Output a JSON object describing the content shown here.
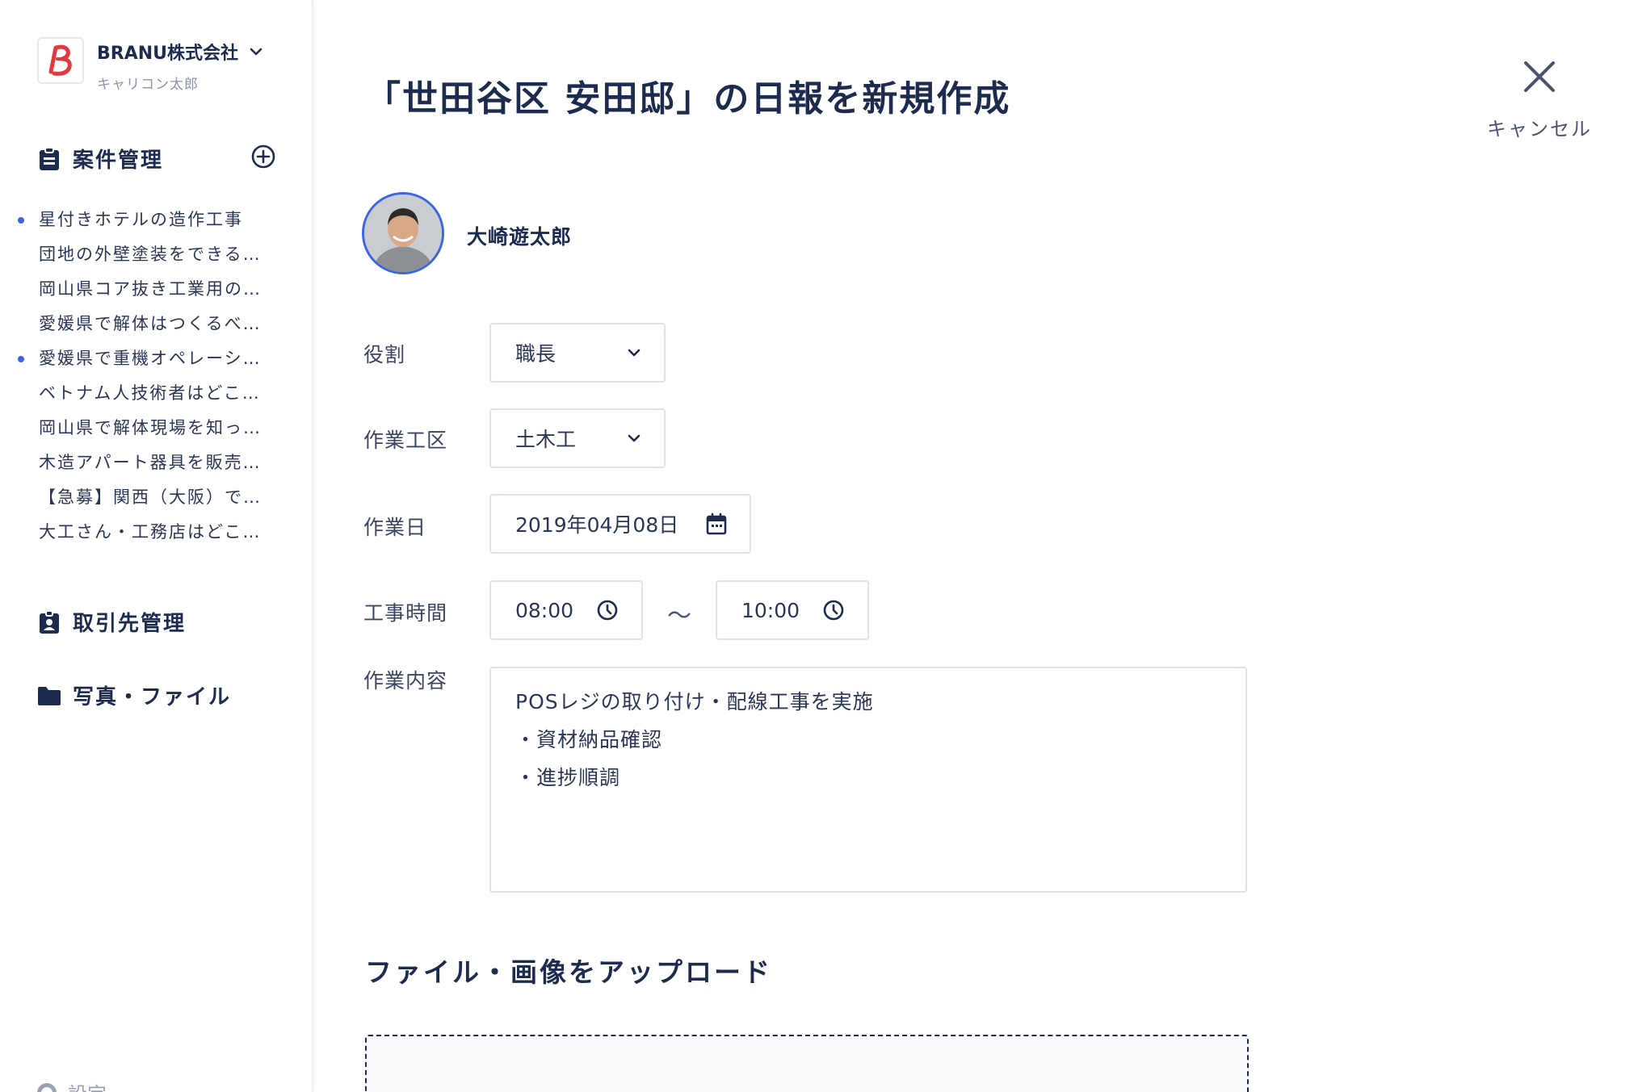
{
  "company": {
    "name": "BRANU株式会社",
    "user": "キャリコン太郎",
    "logo_letter": "B"
  },
  "nav": {
    "projects_label": "案件管理",
    "projects": [
      {
        "label": "星付きホテルの造作工事",
        "unread": true
      },
      {
        "label": "団地の外壁塗装をできる…",
        "unread": false
      },
      {
        "label": "岡山県コア抜き工業用の…",
        "unread": false
      },
      {
        "label": "愛媛県で解体はつくるべ…",
        "unread": false
      },
      {
        "label": "愛媛県で重機オペレーシ…",
        "unread": true
      },
      {
        "label": "ベトナム人技術者はどこ…",
        "unread": false
      },
      {
        "label": "岡山県で解体現場を知っ…",
        "unread": false
      },
      {
        "label": "木造アパート器具を販売…",
        "unread": false
      },
      {
        "label": "【急募】関西（大阪）で…",
        "unread": false
      },
      {
        "label": "大工さん・工務店はどこ…",
        "unread": false
      }
    ],
    "clients_label": "取引先管理",
    "files_label": "写真・ファイル",
    "settings_label": "設定"
  },
  "page": {
    "title": "「世田谷区 安田邸」の日報を新規作成",
    "cancel_label": "キャンセル"
  },
  "author": {
    "name": "大崎遊太郎"
  },
  "form": {
    "role_label": "役割",
    "role_value": "職長",
    "area_label": "作業工区",
    "area_value": "土木工",
    "date_label": "作業日",
    "date_value": "2019年04月08日",
    "time_label": "工事時間",
    "time_start": "08:00",
    "time_separator": "〜",
    "time_end": "10:00",
    "content_label": "作業内容",
    "content_lines": [
      "POSレジの取り付け・配線工事を実施",
      "・資材納品確認",
      "・進捗順調"
    ]
  },
  "upload": {
    "title": "ファイル・画像をアップロード"
  },
  "colors": {
    "primary": "#1d2b4f",
    "accent": "#3b66e0",
    "logo_red": "#e2383f",
    "border": "#dfe2e8"
  },
  "icons": {
    "projects": "clipboard-icon",
    "add": "plus-circle-icon",
    "clients": "id-badge-icon",
    "files": "folder-icon",
    "close": "close-icon",
    "dropdown": "chevron-down-icon",
    "date": "calendar-icon",
    "time": "clock-icon"
  }
}
